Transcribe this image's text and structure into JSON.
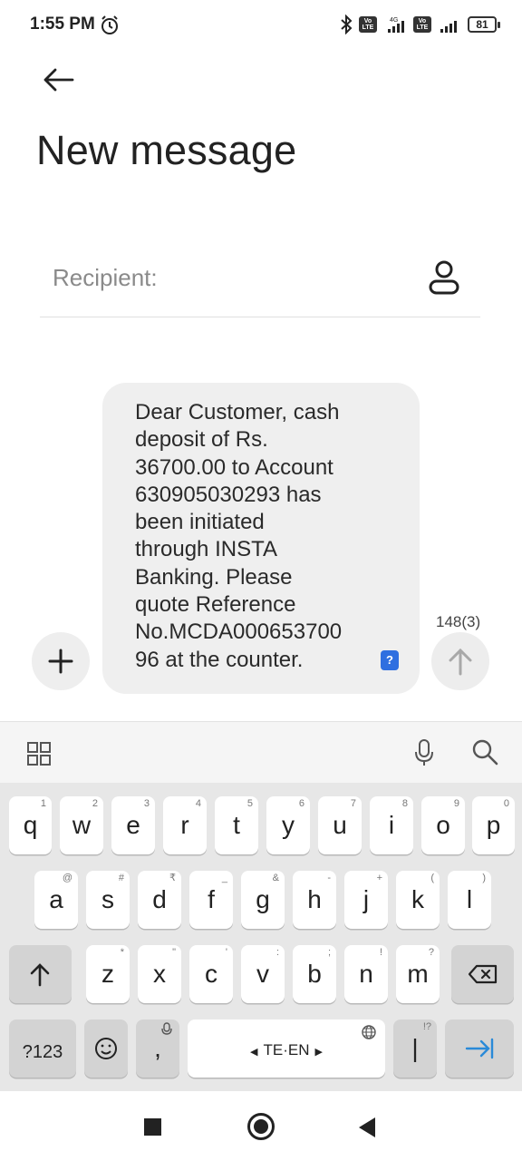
{
  "status_bar": {
    "time": "1:55 PM",
    "network_label": "4G",
    "volte_label": "Vo LTE",
    "battery": "81"
  },
  "header": {
    "title": "New message",
    "back_icon": "back-arrow-icon"
  },
  "recipient": {
    "placeholder": "Recipient:",
    "value": "",
    "contact_icon": "contact-icon"
  },
  "message": {
    "text": "Dear Customer, cash\ndeposit of Rs.\n36700.00 to Account\n630905030293 has\nbeen initiated\nthrough INSTA\nBanking. Please\nquote Reference\nNo.MCDA000653700\n96 at the counter.",
    "badge": "?",
    "char_count": "148(3)"
  },
  "colors": {
    "accent": "#2f6fe0",
    "bubble": "#efefef",
    "keyboard_bg": "#e7e7e7"
  },
  "keyboard": {
    "row1": [
      {
        "key": "q",
        "hint": "1"
      },
      {
        "key": "w",
        "hint": "2"
      },
      {
        "key": "e",
        "hint": "3"
      },
      {
        "key": "r",
        "hint": "4"
      },
      {
        "key": "t",
        "hint": "5"
      },
      {
        "key": "y",
        "hint": "6"
      },
      {
        "key": "u",
        "hint": "7"
      },
      {
        "key": "i",
        "hint": "8"
      },
      {
        "key": "o",
        "hint": "9"
      },
      {
        "key": "p",
        "hint": "0"
      }
    ],
    "row2": [
      {
        "key": "a",
        "hint": "@"
      },
      {
        "key": "s",
        "hint": "#"
      },
      {
        "key": "d",
        "hint": "₹"
      },
      {
        "key": "f",
        "hint": "_"
      },
      {
        "key": "g",
        "hint": "&"
      },
      {
        "key": "h",
        "hint": "-"
      },
      {
        "key": "j",
        "hint": "+"
      },
      {
        "key": "k",
        "hint": "("
      },
      {
        "key": "l",
        "hint": ")"
      }
    ],
    "row3": [
      {
        "key": "z",
        "hint": "*"
      },
      {
        "key": "x",
        "hint": "\""
      },
      {
        "key": "c",
        "hint": "'"
      },
      {
        "key": "v",
        "hint": ":"
      },
      {
        "key": "b",
        "hint": ";"
      },
      {
        "key": "n",
        "hint": "!"
      },
      {
        "key": "m",
        "hint": "?"
      }
    ],
    "symbols_label": "?123",
    "comma": ",",
    "space_label": "TE·EN",
    "period": "|",
    "period_hint": "!?",
    "shift_icon": "shift-arrow-icon",
    "backspace_icon": "backspace-icon",
    "enter_icon": "tab-enter-icon"
  }
}
